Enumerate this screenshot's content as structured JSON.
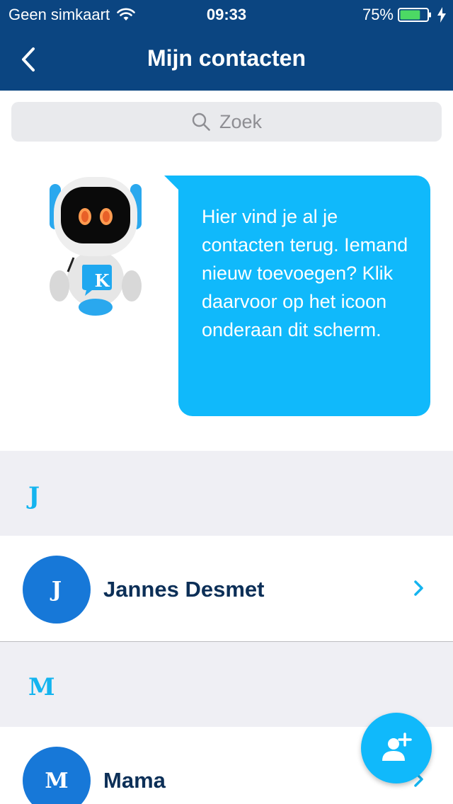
{
  "status_bar": {
    "carrier": "Geen simkaart",
    "time": "09:33",
    "battery": "75%",
    "battery_level": 0.75
  },
  "nav": {
    "title": "Mijn contacten"
  },
  "search": {
    "placeholder": "Zoek"
  },
  "assistant": {
    "message": "Hier vind je al je contacten terug. Iemand nieuw toevoegen? Klik daarvoor op het icoon onderaan dit scherm.",
    "badge_letter": "K"
  },
  "sections": [
    {
      "letter": "J",
      "contacts": [
        {
          "initial": "J",
          "name": "Jannes Desmet"
        }
      ]
    },
    {
      "letter": "M",
      "contacts": [
        {
          "initial": "M",
          "name": "Mama"
        }
      ]
    }
  ],
  "colors": {
    "header": "#0b4581",
    "accent": "#10b9fb",
    "avatar": "#1778d8",
    "name_text": "#0c2f57"
  },
  "icons": {
    "back": "chevron-left-icon",
    "search": "search-icon",
    "chevron": "chevron-right-icon",
    "fab": "add-person-icon"
  }
}
